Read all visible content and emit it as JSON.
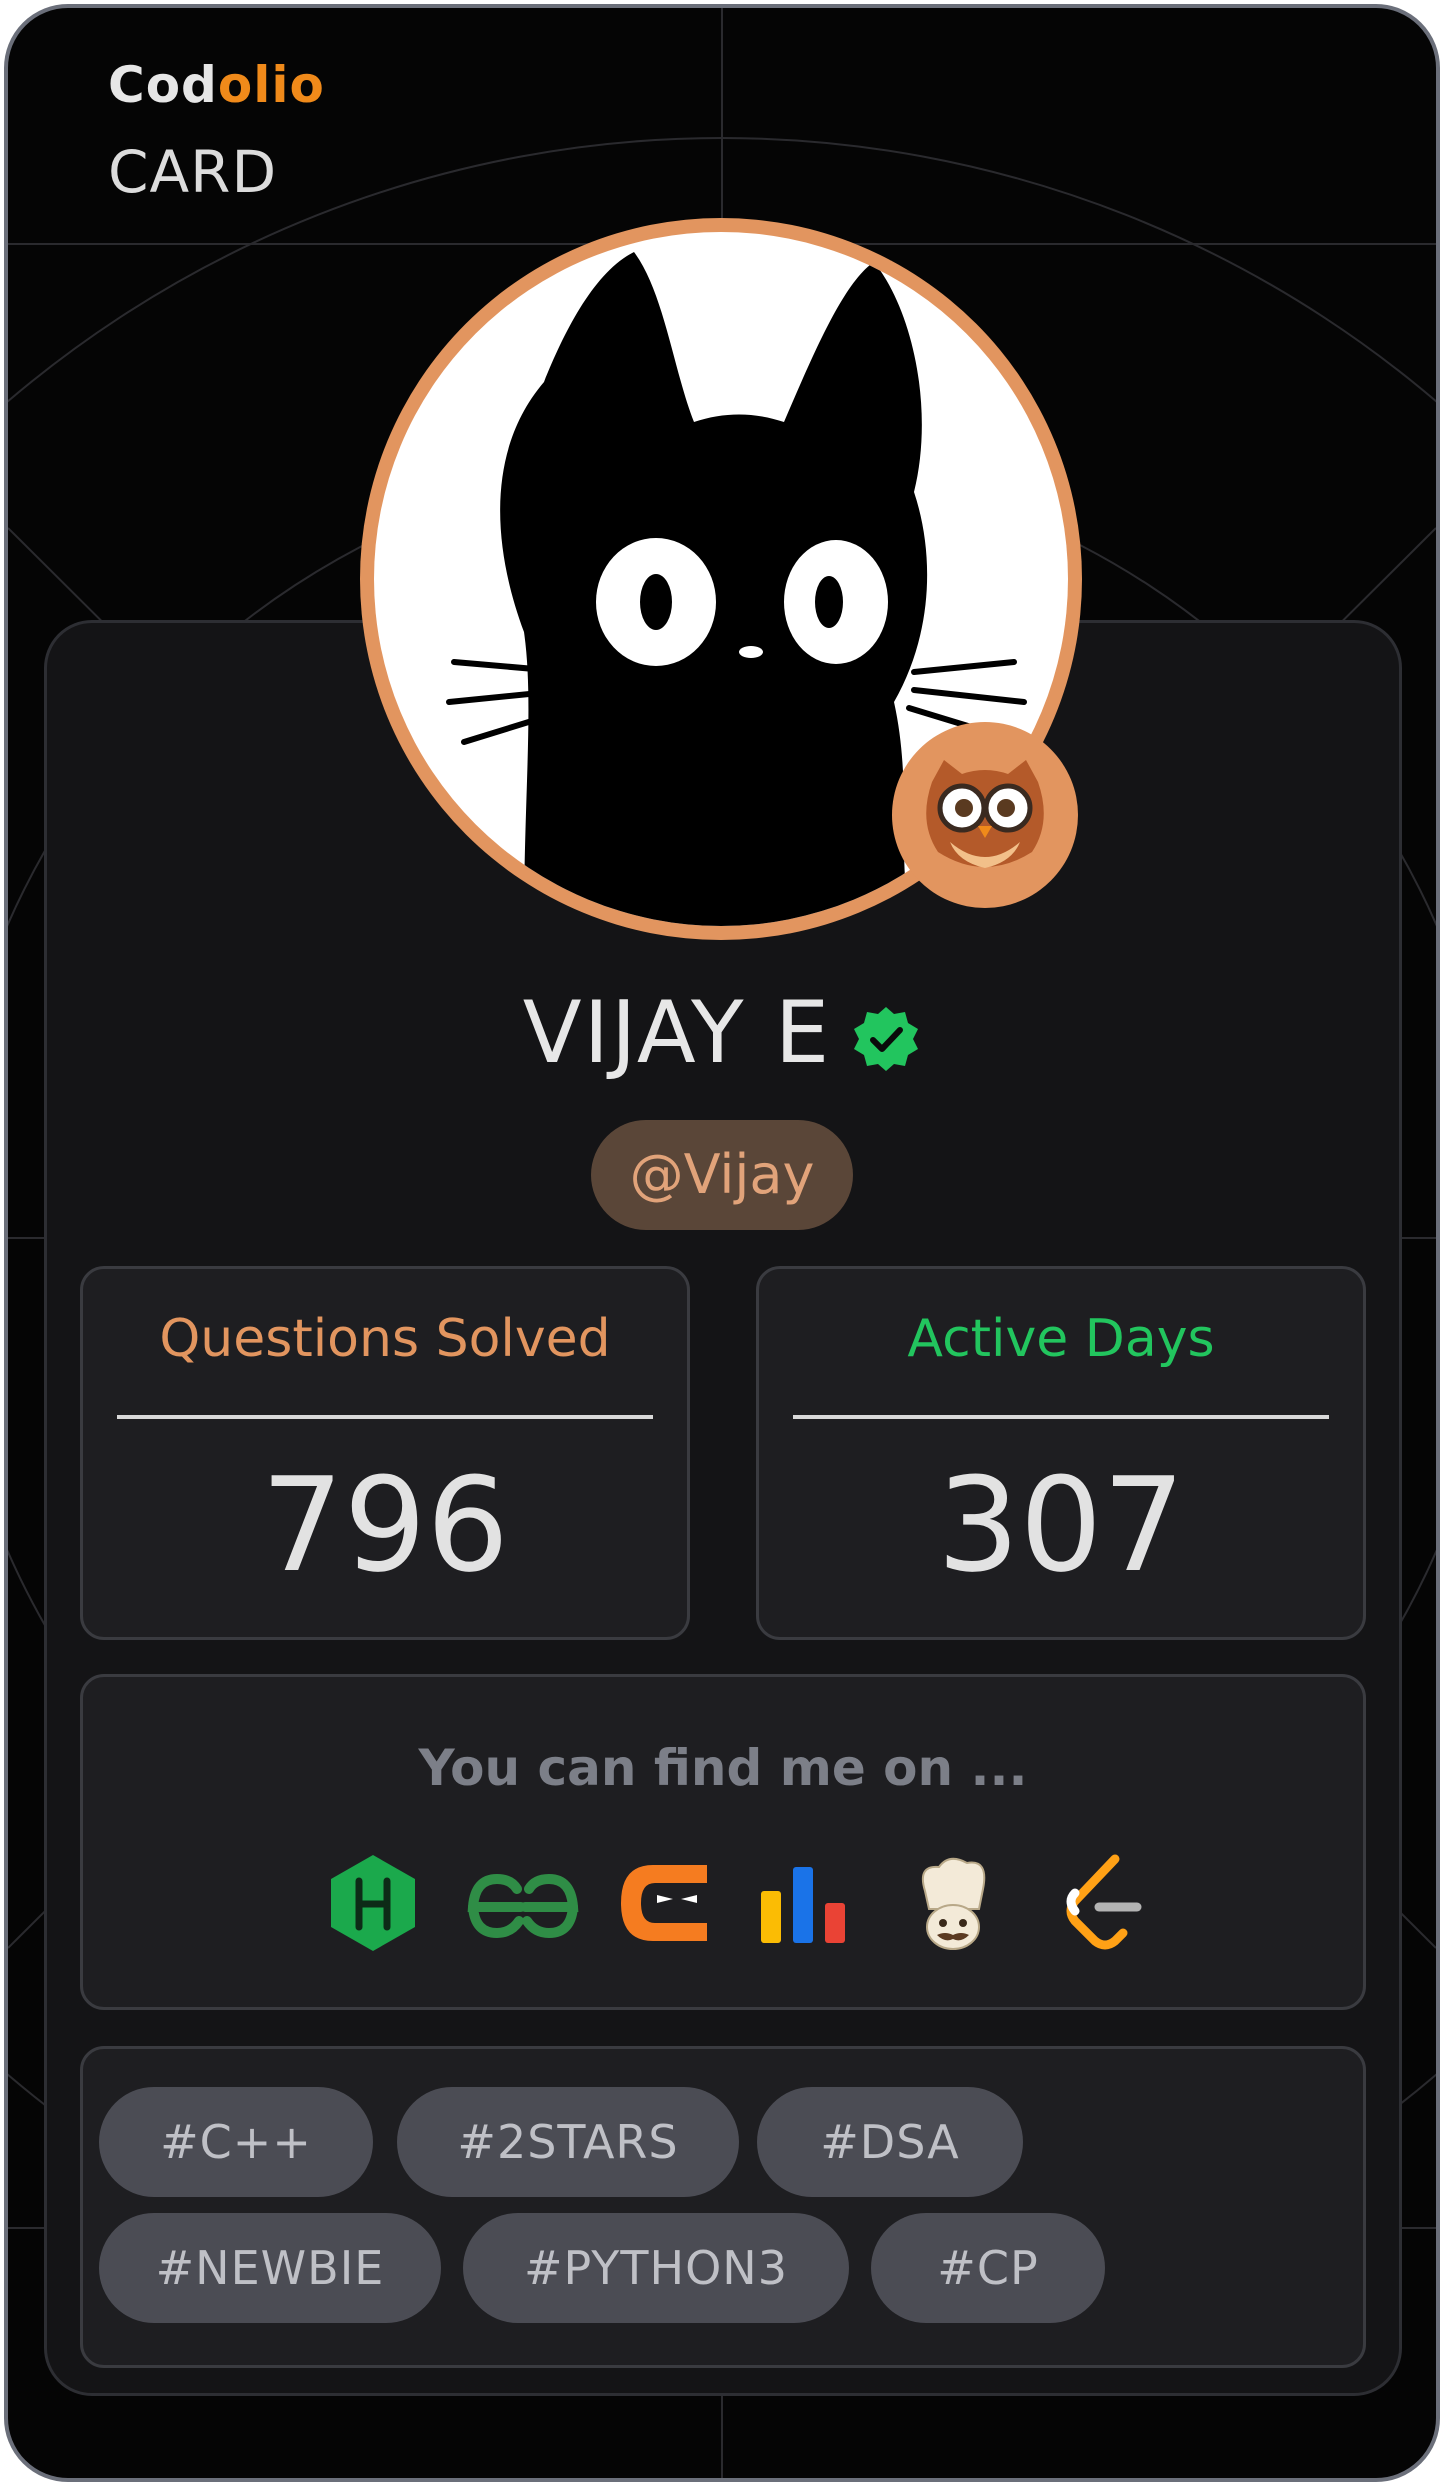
{
  "brand": {
    "name_part1": "Cod",
    "name_part2": "olio",
    "subtitle": "CARD"
  },
  "profile": {
    "name": "VIJAY E",
    "handle": "@Vijay",
    "avatar_icon": "black-cat-icon",
    "badge_icon": "owl-icon",
    "verified_icon": "verified-check-icon"
  },
  "stats": [
    {
      "label": "Questions Solved",
      "value": "796",
      "color": "#e2955f"
    },
    {
      "label": "Active Days",
      "value": "307",
      "color": "#22c55e"
    }
  ],
  "platforms": {
    "title": "You can find me on ...",
    "items": [
      {
        "icon": "hackerrank-icon"
      },
      {
        "icon": "geeksforgeeks-icon"
      },
      {
        "icon": "codestudio-icon"
      },
      {
        "icon": "interviewbit-icon"
      },
      {
        "icon": "codechef-icon"
      },
      {
        "icon": "leetcode-icon"
      }
    ]
  },
  "tags": [
    "#C++",
    "#2STARS",
    "#DSA",
    "#NEWBIE",
    "#PYTHON3",
    "#CP"
  ],
  "colors": {
    "accent": "#f08a1a",
    "peach": "#e2955f",
    "green": "#22c55e"
  }
}
